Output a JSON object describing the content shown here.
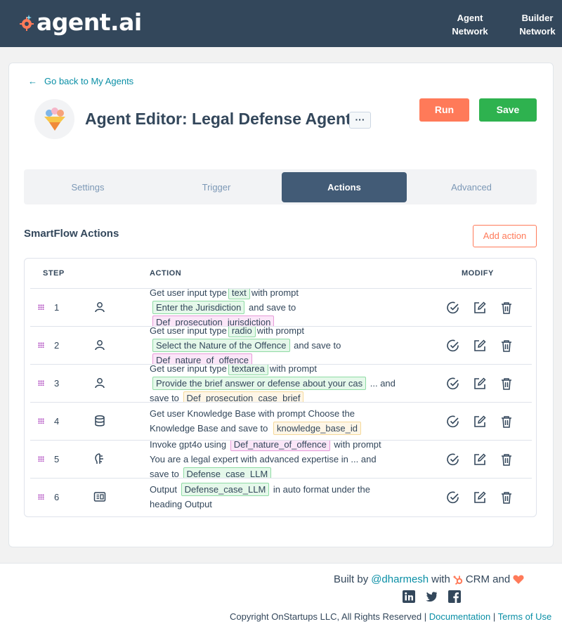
{
  "header": {
    "logo_text": "agent.ai",
    "nav": [
      {
        "line1": "Agent",
        "line2": "Network"
      },
      {
        "line1": "Builder",
        "line2": "Network"
      }
    ]
  },
  "editor": {
    "back_link": "Go back to My Agents",
    "title": "Agent Editor: Legal Defense Agent",
    "more_label": "···",
    "run_label": "Run",
    "save_label": "Save"
  },
  "tabs": [
    {
      "label": "Settings",
      "active": false
    },
    {
      "label": "Trigger",
      "active": false
    },
    {
      "label": "Actions",
      "active": true
    },
    {
      "label": "Advanced",
      "active": false
    }
  ],
  "actions_section": {
    "title": "SmartFlow Actions",
    "add_label": "Add action",
    "columns": {
      "step": "STEP",
      "action": "ACTION",
      "modify": "MODIFY"
    },
    "rows": [
      {
        "step": "1",
        "icon": "user-icon",
        "pre": "Get user input type",
        "type": "text",
        "mid": "with prompt",
        "prompt": "Enter the Jurisdiction",
        "post": "and save to",
        "var": "Def_prosecution_jurisdiction"
      },
      {
        "step": "2",
        "icon": "user-icon",
        "pre": "Get user input type",
        "type": "radio",
        "mid": "with prompt",
        "prompt": "Select the Nature of the Offence",
        "post": "and save to",
        "var": "Def_nature_of_offence"
      },
      {
        "step": "3",
        "icon": "user-icon",
        "pre": "Get user input type",
        "type": "textarea",
        "mid": "with prompt",
        "prompt": "Provide the brief answer or defense about your cas",
        "post": "... and",
        "save_to": "save to",
        "var": "Def_prosecution_case_brief"
      },
      {
        "step": "4",
        "icon": "database-icon",
        "line1": "Get user Knowledge Base with prompt Choose the",
        "line2": "Knowledge Base and save to",
        "var": "knowledge_base_id"
      },
      {
        "step": "5",
        "icon": "brain-icon",
        "pre": "Invoke gpt4o using",
        "input": "Def_nature_of_offence",
        "mid": "with prompt",
        "line2": "You are a legal expert with advanced expertise in ... and",
        "save_to": "save to",
        "var": "Defense_case_LLM"
      },
      {
        "step": "6",
        "icon": "output-icon",
        "pre": "Output",
        "var": "Defense_case_LLM",
        "mid": "in auto format under the",
        "line2": "heading Output"
      }
    ]
  },
  "footer": {
    "built_by": "Built by",
    "author": "@dharmesh",
    "with": "with",
    "crm": "CRM and",
    "copyright": "Copyright OnStartups LLC, All Rights Reserved |",
    "docs": "Documentation",
    "sep": "|",
    "terms": "Terms of Use"
  },
  "colors": {
    "header_bg": "#33475b",
    "accent_orange": "#ff7a59",
    "save_green": "#2eb24f",
    "active_tab": "#425b76",
    "link_teal": "#0a8fa6"
  }
}
